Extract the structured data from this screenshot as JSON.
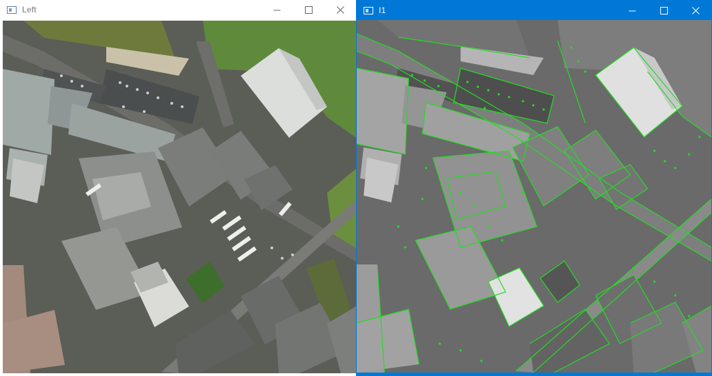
{
  "windows": {
    "left": {
      "title": "Left",
      "icon": "opencv-window-icon",
      "active": false,
      "controls": [
        "minimize-icon",
        "maximize-icon",
        "close-icon"
      ],
      "content": "aerial-photo-color"
    },
    "right": {
      "title": "I1",
      "icon": "opencv-window-icon",
      "active": true,
      "controls": [
        "minimize-icon",
        "maximize-icon",
        "close-icon"
      ],
      "content": "aerial-photo-grayscale-with-edge-overlay"
    }
  },
  "colors": {
    "active_titlebar": "#0078d7",
    "inactive_titlebar": "#ffffff",
    "edge_overlay": "#22dd22"
  }
}
